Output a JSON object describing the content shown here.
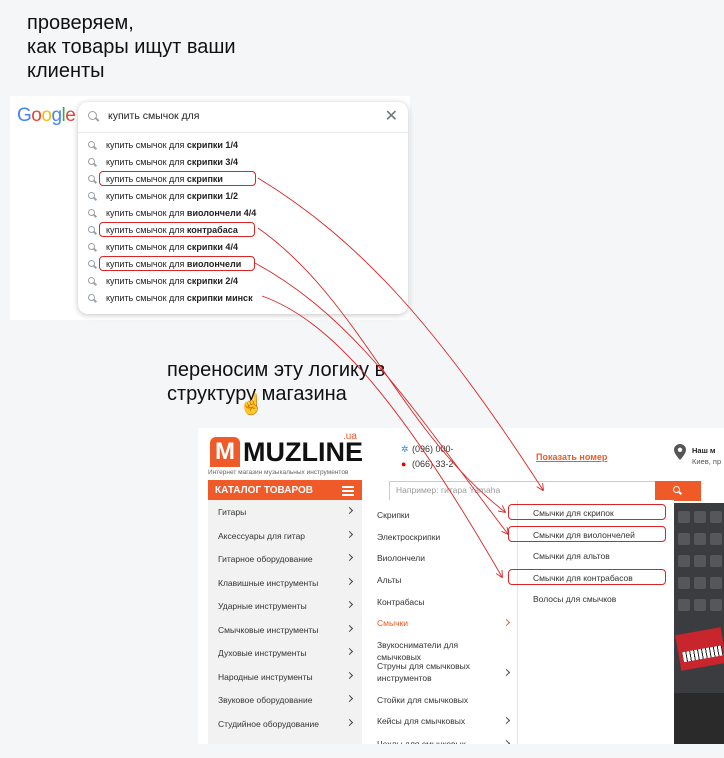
{
  "headings": {
    "top": "проверяем,\nкак товары ищут ваши\nклиенты",
    "middle": "переносим эту логику в\nструктуру магазина"
  },
  "google": {
    "logo_text": "Google",
    "logo_colors": [
      "#4285F4",
      "#EA4335",
      "#FBBC05",
      "#4285F4",
      "#34A853",
      "#EA4335"
    ],
    "query": "купить смычок для",
    "suggestions": [
      {
        "prefix": "купить смычок для ",
        "bold": "скрипки 1/4",
        "highlighted": false
      },
      {
        "prefix": "купить смычок для ",
        "bold": "скрипки 3/4",
        "highlighted": false
      },
      {
        "prefix": "купить смычок для ",
        "bold": "скрипки",
        "highlighted": true
      },
      {
        "prefix": "купить смычок для ",
        "bold": "скрипки 1/2",
        "highlighted": false
      },
      {
        "prefix": "купить смычок для ",
        "bold": "виолончели 4/4",
        "highlighted": false
      },
      {
        "prefix": "купить смычок для ",
        "bold": "контрабаса",
        "highlighted": true
      },
      {
        "prefix": "купить смычок для ",
        "bold": "скрипки 4/4",
        "highlighted": false
      },
      {
        "prefix": "купить смычок для ",
        "bold": "виолончели",
        "highlighted": true
      },
      {
        "prefix": "купить смычок для ",
        "bold": "скрипки 2/4",
        "highlighted": false
      },
      {
        "prefix": "купить смычок для ",
        "bold": "скрипки минск",
        "highlighted": false
      }
    ]
  },
  "shop": {
    "logo_text": "MUZLINE",
    "logo_domain": ".ua",
    "logo_tagline": "Интернет магазин музыкальных инструментов",
    "phone1": "(096) 000-",
    "phone2": "(066) 33-2",
    "show_number": "Показать номер",
    "address_title": "Наш м",
    "address_city": "Киев, пр",
    "catalog_label": "КАТАЛОГ ТОВАРОВ",
    "search_placeholder": "Например: гитара Yamaha",
    "categories": [
      "Гитары",
      "Аксессуары для гитар",
      "Гитарное оборудование",
      "Клавишные инструменты",
      "Ударные инструменты",
      "Смычковые инструменты",
      "Духовые инструменты",
      "Народные инструменты",
      "Звуковое оборудование",
      "Студийное оборудование"
    ],
    "subcategories": [
      {
        "label": "Скрипки",
        "arrow": false,
        "active": false
      },
      {
        "label": "Электроскрипки",
        "arrow": false,
        "active": false
      },
      {
        "label": "Виолончели",
        "arrow": false,
        "active": false
      },
      {
        "label": "Альты",
        "arrow": false,
        "active": false
      },
      {
        "label": "Контрабасы",
        "arrow": false,
        "active": false
      },
      {
        "label": "Смычки",
        "arrow": true,
        "active": true
      },
      {
        "label": "Звукосниматели для смычковых",
        "arrow": false,
        "active": false
      },
      {
        "label": "Струны для смычковых инструментов",
        "arrow": true,
        "active": false
      },
      {
        "label": "Стойки для смычковых",
        "arrow": false,
        "active": false
      },
      {
        "label": "Кейсы для смычковых",
        "arrow": true,
        "active": false
      },
      {
        "label": "Чехлы для смычковых",
        "arrow": true,
        "active": false
      }
    ],
    "bow_items": [
      {
        "label": "Смычки для скрипок",
        "highlighted": true
      },
      {
        "label": "Смычки для виолончелей",
        "highlighted": true
      },
      {
        "label": "Смычки для альтов",
        "highlighted": false
      },
      {
        "label": "Смычки для контрабасов",
        "highlighted": true
      },
      {
        "label": "Волосы для смычков",
        "highlighted": false
      }
    ]
  },
  "colors": {
    "accent": "#f05a28",
    "highlight": "#d92525"
  }
}
